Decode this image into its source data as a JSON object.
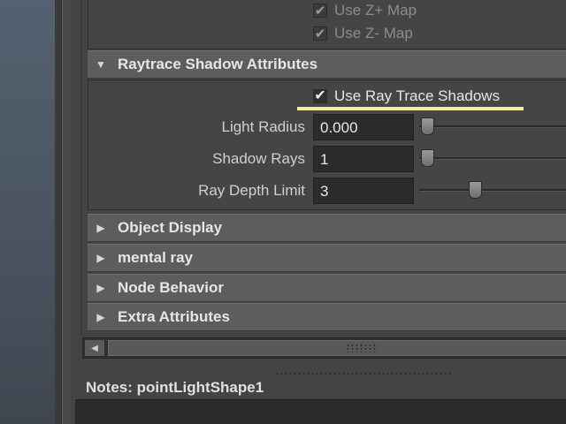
{
  "prev_section": {
    "checkboxes": [
      {
        "label": "Use Z+ Map",
        "checked": true
      },
      {
        "label": "Use Z- Map",
        "checked": true
      }
    ]
  },
  "raytrace": {
    "title": "Raytrace Shadow Attributes",
    "expanded": true,
    "use_ray_trace": {
      "label": "Use Ray Trace Shadows",
      "checked": true
    },
    "attrs": [
      {
        "label": "Light Radius",
        "value": "0.000",
        "slider_fraction": 0.0
      },
      {
        "label": "Shadow Rays",
        "value": "1",
        "slider_fraction": 0.0
      },
      {
        "label": "Ray Depth Limit",
        "value": "3",
        "slider_fraction": 0.35
      }
    ]
  },
  "collapsed_sections": [
    {
      "title": "Object Display"
    },
    {
      "title": "mental ray"
    },
    {
      "title": "Node Behavior"
    },
    {
      "title": "Extra Attributes"
    }
  ],
  "notes": {
    "label": "Notes:  pointLightShape1"
  },
  "colors": {
    "highlight": "#f4ef96",
    "header_bg": "#5d5d5d",
    "field_bg": "#2b2b2b"
  },
  "icons": {
    "expanded": "triangle-down-icon",
    "collapsed": "triangle-right-icon",
    "check": "checkmark-icon"
  }
}
